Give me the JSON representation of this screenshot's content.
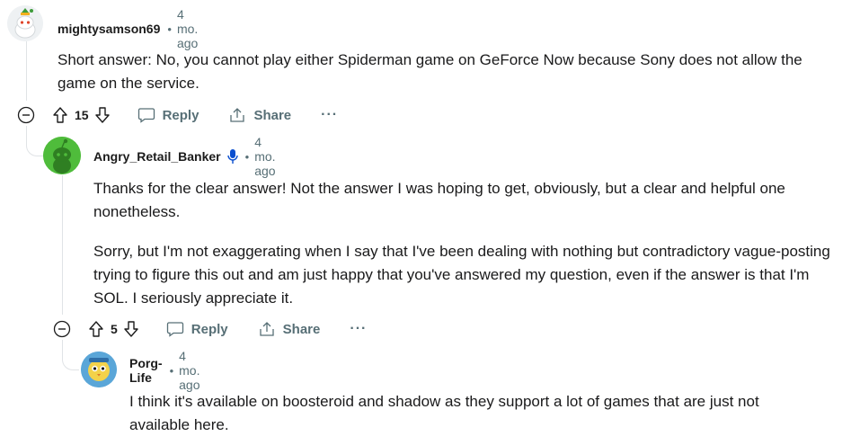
{
  "comments": [
    {
      "username": "mightysamson69",
      "age": "4 mo. ago",
      "paragraphs": [
        "Short answer: No, you cannot play either Spiderman game on GeForce Now because Sony does not allow the game on the service."
      ],
      "votes": "15",
      "reply_label": "Reply",
      "share_label": "Share",
      "more_label": "···"
    },
    {
      "username": "Angry_Retail_Banker",
      "age": "4 mo. ago",
      "paragraphs": [
        "Thanks for the clear answer! Not the answer I was hoping to get, obviously, but a clear and helpful one nonetheless.",
        "Sorry, but I'm not exaggerating when I say that I've been dealing with nothing but contradictory vague-posting trying to figure this out and am just happy that you've answered my question, even if the answer is that I'm SOL. I seriously appreciate it."
      ],
      "votes": "5",
      "reply_label": "Reply",
      "share_label": "Share",
      "more_label": "···"
    },
    {
      "username": "Porg-Life",
      "age": "4 mo. ago",
      "paragraphs": [
        "I think it's available on boosteroid and shadow as they support a lot of games that are just not available here."
      ]
    }
  ],
  "separator": "•",
  "colors": {
    "meta": "#576f76",
    "thread_line": "#e0e3e6",
    "mic_blue": "#0a4fcf",
    "avatar_green": "#4fbc3b"
  }
}
